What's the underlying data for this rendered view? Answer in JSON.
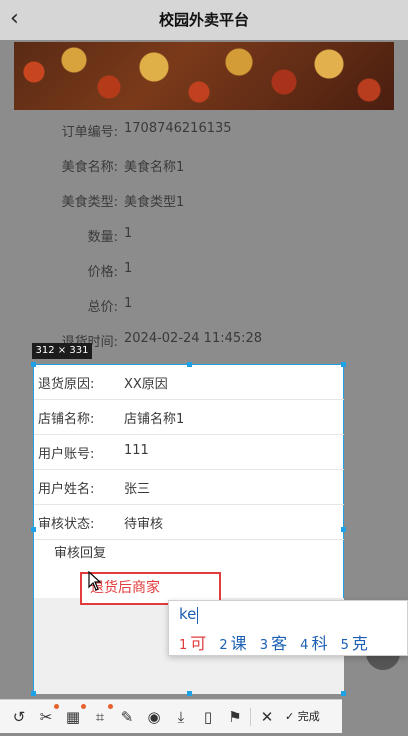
{
  "navbar": {
    "back_icon": "‹",
    "title": "校园外卖平台"
  },
  "order": {
    "rows_above": [
      {
        "label": "订单编号:",
        "value": "1708746216135"
      },
      {
        "label": "美食名称:",
        "value": "美食名称1"
      },
      {
        "label": "美食类型:",
        "value": "美食类型1"
      },
      {
        "label": "数量:",
        "value": "1"
      },
      {
        "label": "价格:",
        "value": "1"
      },
      {
        "label": "总价:",
        "value": "1"
      },
      {
        "label": "退货时间:",
        "value": "2024-02-24 11:45:28"
      }
    ],
    "rows_in_selection": [
      {
        "label": "退货原因:",
        "value": "XX原因"
      },
      {
        "label": "店铺名称:",
        "value": "店铺名称1"
      },
      {
        "label": "用户账号:",
        "value": "111"
      },
      {
        "label": "用户姓名:",
        "value": "张三"
      },
      {
        "label": "审核状态:",
        "value": "待审核"
      }
    ],
    "reply_label": "审核回复",
    "reply_value": "退货后商家"
  },
  "selection": {
    "size_label": "312 × 331",
    "accent": "#1ea1e6"
  },
  "ime": {
    "composition": "ke",
    "candidates": [
      {
        "n": "1",
        "text": "可"
      },
      {
        "n": "2",
        "text": "课"
      },
      {
        "n": "3",
        "text": "客"
      },
      {
        "n": "4",
        "text": "科"
      },
      {
        "n": "5",
        "text": "克"
      }
    ]
  },
  "toolbar": {
    "icons": [
      "undo-icon",
      "scissors-icon",
      "ocr-icon",
      "crop-icon",
      "pin-icon",
      "record-icon",
      "download-icon",
      "phone-icon",
      "bookmark-icon",
      "close-icon"
    ],
    "done_label": "完成"
  }
}
